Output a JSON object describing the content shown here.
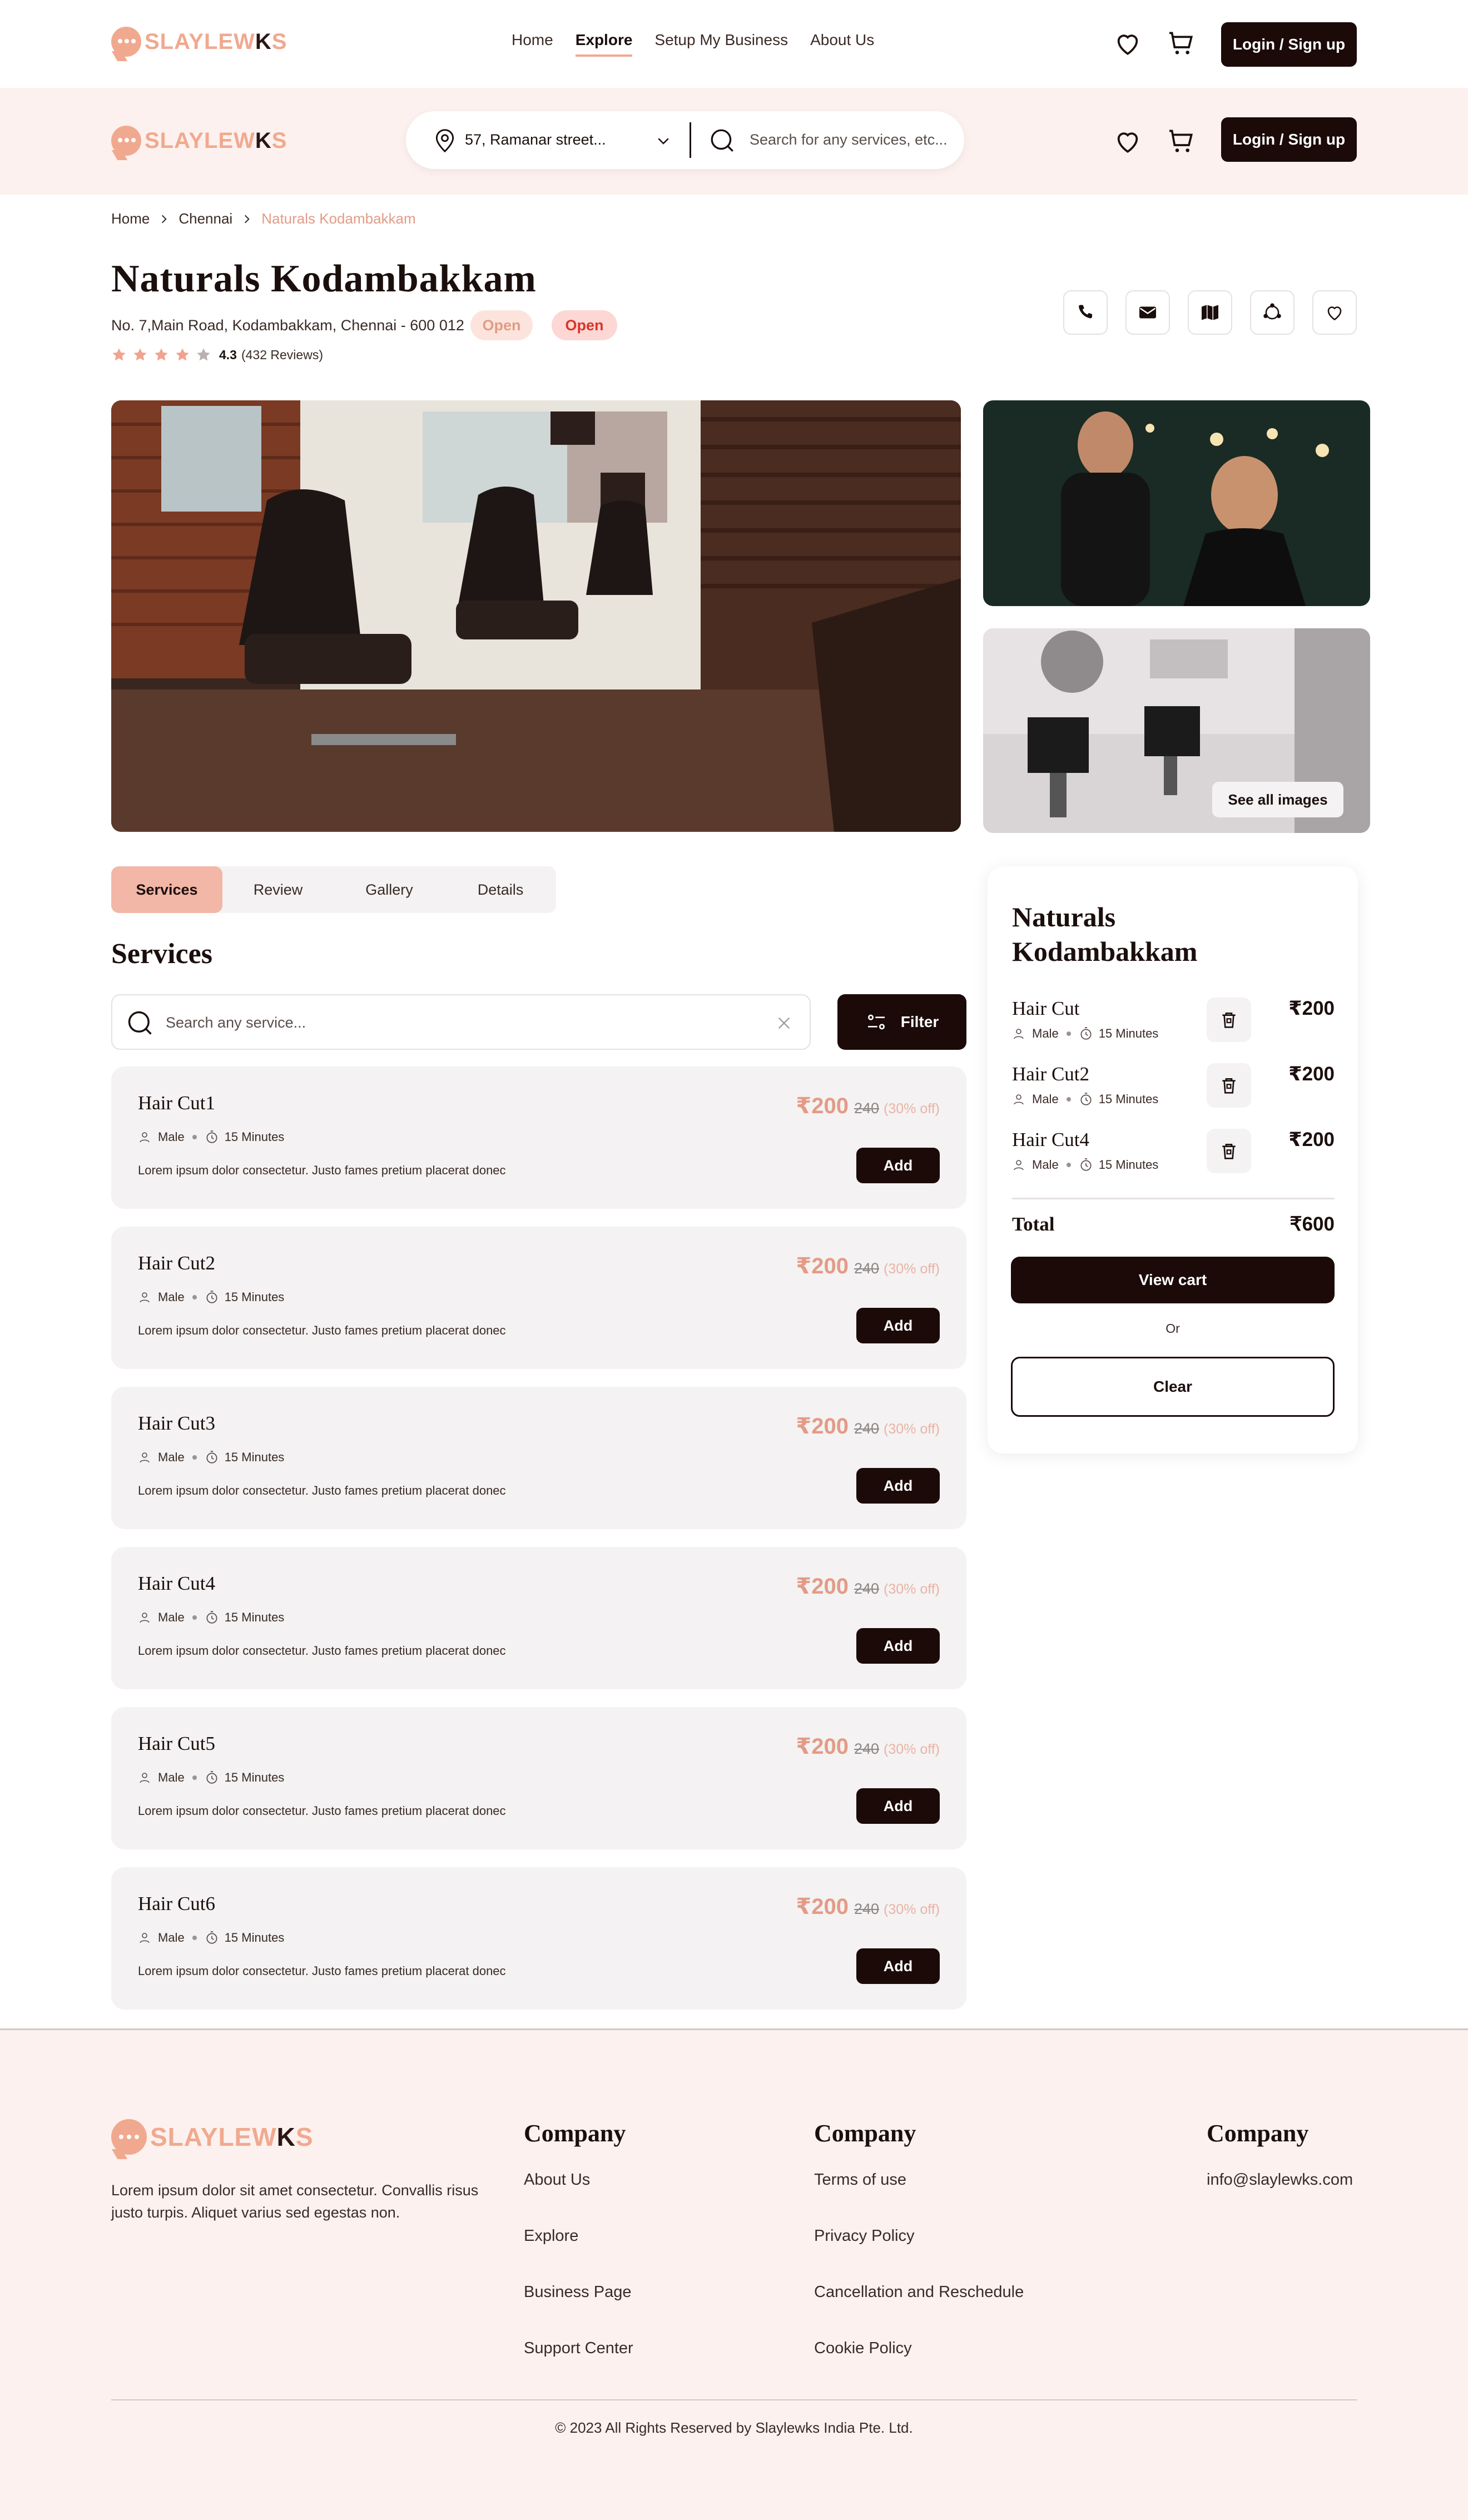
{
  "brand": {
    "logo_main": "SLAYLEW",
    "logo_k": "K",
    "logo_end": "S"
  },
  "nav": {
    "links": [
      "Home",
      "Explore",
      "Setup My Business",
      "About Us"
    ],
    "active": "Explore",
    "login_label": "Login / Sign up"
  },
  "search": {
    "location": "57, Ramanar street...",
    "placeholder": "Search for any services, etc..."
  },
  "breadcrumb": [
    "Home",
    "Chennai",
    "Naturals Kodambakkam"
  ],
  "salon": {
    "name": "Naturals Kodambakkam",
    "address": "No. 7,Main Road, Kodambakkam, Chennai - 600 012",
    "status_a": "Open",
    "status_b": "Open",
    "rating": "4.3",
    "reviews": "(432 Reviews)",
    "stars_filled": 4,
    "stars_total": 5
  },
  "gallery": {
    "see_all_label": "See all images"
  },
  "tabs": [
    "Services",
    "Review",
    "Gallery",
    "Details"
  ],
  "services": {
    "heading": "Services",
    "search_placeholder": "Search any service...",
    "filter_label": "Filter",
    "items": [
      {
        "name": "Hair Cut1",
        "gender": "Male",
        "duration": "15 Minutes",
        "description": "Lorem ipsum dolor consectetur. Justo fames pretium placerat donec",
        "price": "₹200",
        "old_price": "240",
        "discount": "(30% off)",
        "add_label": "Add"
      },
      {
        "name": "Hair Cut2",
        "gender": "Male",
        "duration": "15 Minutes",
        "description": "Lorem ipsum dolor consectetur. Justo fames pretium placerat donec",
        "price": "₹200",
        "old_price": "240",
        "discount": "(30% off)",
        "add_label": "Add"
      },
      {
        "name": "Hair Cut3",
        "gender": "Male",
        "duration": "15 Minutes",
        "description": "Lorem ipsum dolor consectetur. Justo fames pretium placerat donec",
        "price": "₹200",
        "old_price": "240",
        "discount": "(30% off)",
        "add_label": "Add"
      },
      {
        "name": "Hair Cut4",
        "gender": "Male",
        "duration": "15 Minutes",
        "description": "Lorem ipsum dolor consectetur. Justo fames pretium placerat donec",
        "price": "₹200",
        "old_price": "240",
        "discount": "(30% off)",
        "add_label": "Add"
      },
      {
        "name": "Hair Cut5",
        "gender": "Male",
        "duration": "15 Minutes",
        "description": "Lorem ipsum dolor consectetur. Justo fames pretium placerat donec",
        "price": "₹200",
        "old_price": "240",
        "discount": "(30% off)",
        "add_label": "Add"
      },
      {
        "name": "Hair Cut6",
        "gender": "Male",
        "duration": "15 Minutes",
        "description": "Lorem ipsum dolor consectetur. Justo fames pretium placerat donec",
        "price": "₹200",
        "old_price": "240",
        "discount": "(30% off)",
        "add_label": "Add"
      }
    ]
  },
  "cart": {
    "title": "Naturals Kodambakkam",
    "items": [
      {
        "name": "Hair Cut",
        "gender": "Male",
        "duration": "15 Minutes",
        "price": "₹200"
      },
      {
        "name": "Hair Cut2",
        "gender": "Male",
        "duration": "15 Minutes",
        "price": "₹200"
      },
      {
        "name": "Hair Cut4",
        "gender": "Male",
        "duration": "15 Minutes",
        "price": "₹200"
      }
    ],
    "total_label": "Total",
    "total_value": "₹600",
    "view_cart_label": "View cart",
    "or_label": "Or",
    "clear_label": "Clear"
  },
  "footer": {
    "description": "Lorem ipsum dolor sit amet consectetur. Convallis risus justo turpis. Aliquet varius sed egestas non.",
    "col1": {
      "heading": "Company",
      "links": [
        "About Us",
        "Explore",
        "Business Page",
        "Support Center"
      ]
    },
    "col2": {
      "heading": "Company",
      "links": [
        "Terms of use",
        "Privacy Policy",
        "Cancellation and Reschedule",
        "Cookie Policy"
      ]
    },
    "col3": {
      "heading": "Company",
      "links": [
        "info@slaylewks.com"
      ]
    },
    "copyright": "© 2023 All Rights Reserved by Slaylewks India Pte. Ltd."
  },
  "colors": {
    "accent": "#f0a98f",
    "dark": "#1b0a08",
    "badge_bg": "#fce4dc",
    "badge_red": "#d9534f",
    "card_bg": "#f4f2f2"
  },
  "icons": [
    "heart-icon",
    "cart-icon",
    "location-pin-icon",
    "search-icon",
    "chevron-down-icon",
    "phone-icon",
    "mail-icon",
    "map-icon",
    "share-icon",
    "star-icon",
    "user-icon",
    "clock-icon",
    "trash-icon",
    "filter-icon",
    "close-icon",
    "chevron-right-icon"
  ]
}
